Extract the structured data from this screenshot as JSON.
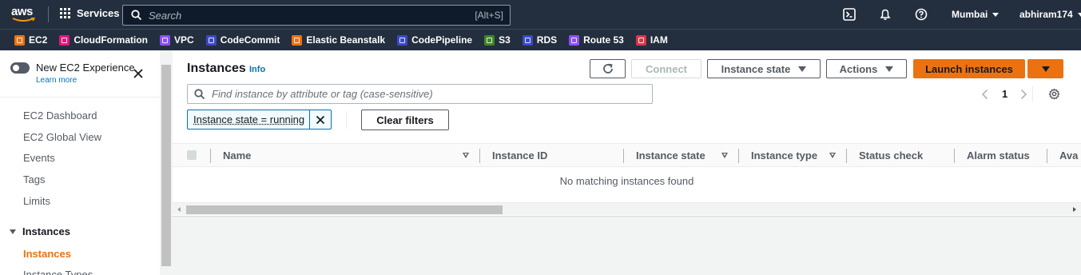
{
  "topnav": {
    "logo_text": "aws",
    "services_label": "Services",
    "search_placeholder": "Search",
    "search_shortcut": "[Alt+S]",
    "region": "Mumbai",
    "account": "abhiram174",
    "icons": [
      "cloudshell-icon",
      "bell-icon",
      "help-icon"
    ]
  },
  "favorites": [
    {
      "label": "EC2",
      "color": "#ec7211"
    },
    {
      "label": "CloudFormation",
      "color": "#e7157b"
    },
    {
      "label": "VPC",
      "color": "#8c4fff"
    },
    {
      "label": "CodeCommit",
      "color": "#3b48cc"
    },
    {
      "label": "Elastic Beanstalk",
      "color": "#ec7211"
    },
    {
      "label": "CodePipeline",
      "color": "#3b48cc"
    },
    {
      "label": "S3",
      "color": "#3f8624"
    },
    {
      "label": "RDS",
      "color": "#3b48cc"
    },
    {
      "label": "Route 53",
      "color": "#8c4fff"
    },
    {
      "label": "IAM",
      "color": "#dd344c"
    }
  ],
  "sidebar": {
    "toggle_label": "New EC2 Experience",
    "learn_more": "Learn more",
    "links": [
      "EC2 Dashboard",
      "EC2 Global View",
      "Events",
      "Tags",
      "Limits"
    ],
    "section_label": "Instances",
    "section_items": [
      "Instances",
      "Instance Types"
    ]
  },
  "main": {
    "title": "Instances",
    "info": "Info",
    "connect": "Connect",
    "instance_state": "Instance state",
    "actions": "Actions",
    "launch": "Launch instances",
    "filter_placeholder": "Find instance by attribute or tag (case-sensitive)",
    "page_number": "1",
    "chip_label": "Instance state = running",
    "clear_filters": "Clear filters",
    "columns": [
      "Name",
      "Instance ID",
      "Instance state",
      "Instance type",
      "Status check",
      "Alarm status",
      "Ava"
    ],
    "empty_message": "No matching instances found"
  },
  "colors": {
    "nav_bg": "#232f3e",
    "accent": "#ec7211",
    "link": "#0073bb"
  }
}
